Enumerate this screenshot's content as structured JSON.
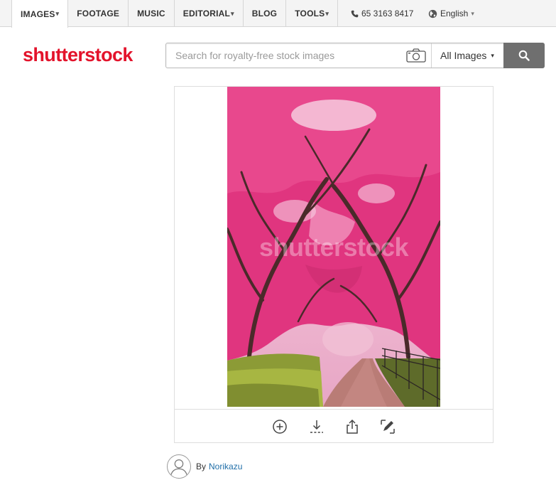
{
  "nav": {
    "items": [
      {
        "label": "IMAGES",
        "caret": "▾"
      },
      {
        "label": "FOOTAGE",
        "caret": ""
      },
      {
        "label": "MUSIC",
        "caret": ""
      },
      {
        "label": "EDITORIAL",
        "caret": "▾"
      },
      {
        "label": "BLOG",
        "caret": ""
      },
      {
        "label": "TOOLS",
        "caret": "▾"
      }
    ],
    "phone": "65 3163 8417",
    "language": "English",
    "language_caret": "▾"
  },
  "header": {
    "logo": "shutterstock",
    "search_placeholder": "Search for royalty-free stock images",
    "filter_label": "All Images",
    "filter_caret": "▾"
  },
  "image": {
    "watermark": "shutterstock",
    "actions": [
      "add-to-lightbox-icon",
      "download-icon",
      "share-icon",
      "edit-icon"
    ]
  },
  "author": {
    "by_label": "By",
    "name": "Norikazu"
  },
  "colors": {
    "brand": "#e3132b",
    "link": "#1f6ea8",
    "search_button": "#6f6f6f",
    "blossom": "#e0357f"
  },
  "icons": {
    "phone": "phone-icon",
    "language": "globe-icon",
    "camera": "camera-icon",
    "search": "search-icon",
    "avatar": "user-avatar-icon"
  }
}
